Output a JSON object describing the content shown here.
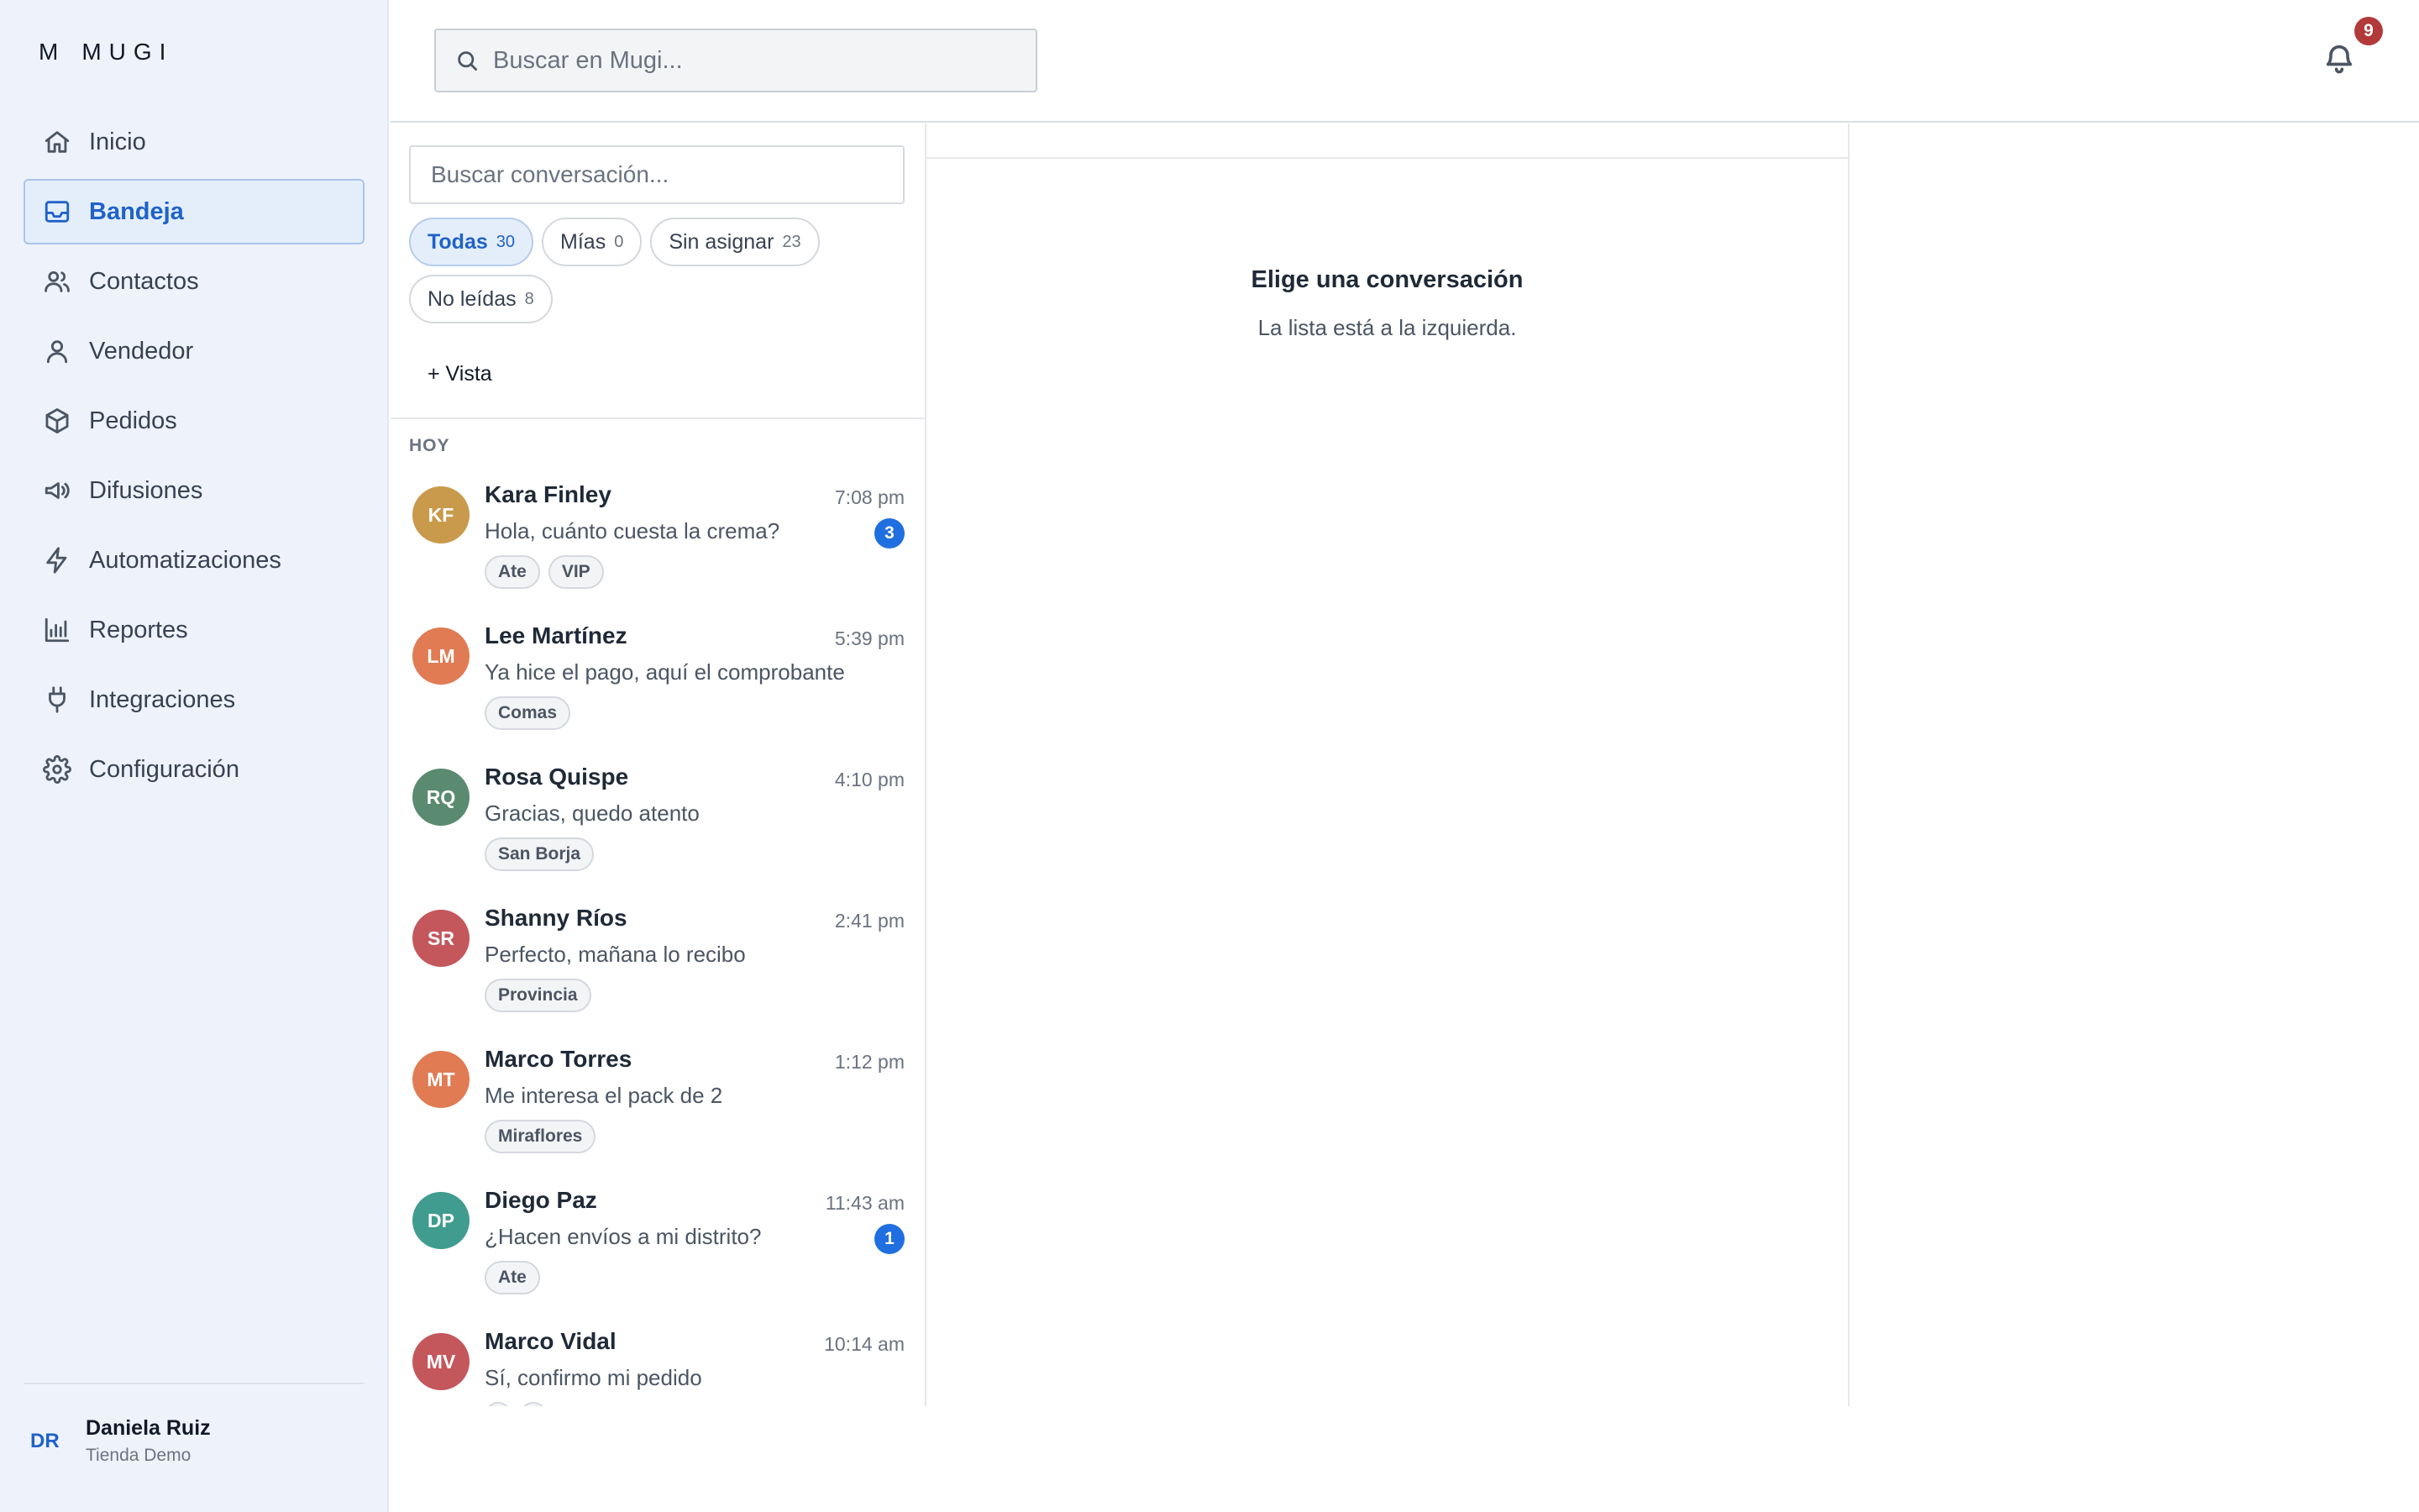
{
  "app": {
    "logo_mark": "M",
    "logo_text": "MUGI"
  },
  "sidebar": {
    "items": [
      {
        "label": "Inicio",
        "icon": "home-icon"
      },
      {
        "label": "Bandeja",
        "icon": "inbox-icon",
        "active": true
      },
      {
        "label": "Contactos",
        "icon": "users-icon"
      },
      {
        "label": "Vendedor",
        "icon": "user-icon"
      },
      {
        "label": "Pedidos",
        "icon": "package-icon"
      },
      {
        "label": "Difusiones",
        "icon": "megaphone-icon"
      },
      {
        "label": "Automatizaciones",
        "icon": "bolt-icon"
      },
      {
        "label": "Reportes",
        "icon": "bar-chart-icon"
      },
      {
        "label": "Integraciones",
        "icon": "plug-icon"
      },
      {
        "label": "Configuración",
        "icon": "gear-icon"
      }
    ],
    "user": {
      "initials": "DR",
      "name": "Daniela Ruiz",
      "store": "Tienda Demo"
    }
  },
  "topbar": {
    "search_placeholder": "Buscar en Mugi...",
    "notifications_count": "9"
  },
  "conversations": {
    "search_placeholder": "Buscar conversación...",
    "filters": [
      {
        "label": "Todas",
        "count": "30",
        "active": true
      },
      {
        "label": "Mías",
        "count": "0"
      },
      {
        "label": "Sin asignar",
        "count": "23"
      },
      {
        "label": "No leídas",
        "count": "8"
      }
    ],
    "add_view": "+ Vista",
    "section": "HOY",
    "items": [
      {
        "initials": "KF",
        "name": "Kara Finley",
        "time": "7:08 pm",
        "message": "Hola, cuánto cuesta la crema?",
        "unread": "3",
        "tags": [
          "Ate",
          "VIP"
        ],
        "color": "#c99a4b"
      },
      {
        "initials": "LM",
        "name": "Lee Martínez",
        "time": "5:39 pm",
        "message": "Ya hice el pago, aquí el comprobante",
        "unread": "",
        "tags": [
          "Comas"
        ],
        "color": "#e07b54"
      },
      {
        "initials": "RQ",
        "name": "Rosa Quispe",
        "time": "4:10 pm",
        "message": "Gracias, quedo atento",
        "unread": "",
        "tags": [
          "San Borja"
        ],
        "color": "#5a8a6f"
      },
      {
        "initials": "SR",
        "name": "Shanny Ríos",
        "time": "2:41 pm",
        "message": "Perfecto, mañana lo recibo",
        "unread": "",
        "tags": [
          "Provincia"
        ],
        "color": "#c4575c"
      },
      {
        "initials": "MT",
        "name": "Marco Torres",
        "time": "1:12 pm",
        "message": "Me interesa el pack de 2",
        "unread": "",
        "tags": [
          "Miraflores"
        ],
        "color": "#e07b54"
      },
      {
        "initials": "DP",
        "name": "Diego Paz",
        "time": "11:43 am",
        "message": "¿Hacen envíos a mi distrito?",
        "unread": "1",
        "tags": [
          "Ate"
        ],
        "color": "#3f9c8f"
      },
      {
        "initials": "MV",
        "name": "Marco Vidal",
        "time": "10:14 am",
        "message": "Sí, confirmo mi pedido",
        "unread": "",
        "tags": [
          "",
          ""
        ],
        "color": "#c4575c"
      }
    ]
  },
  "detail": {
    "empty_title": "Elige una conversación",
    "empty_subtitle": "La lista está a la izquierda."
  }
}
